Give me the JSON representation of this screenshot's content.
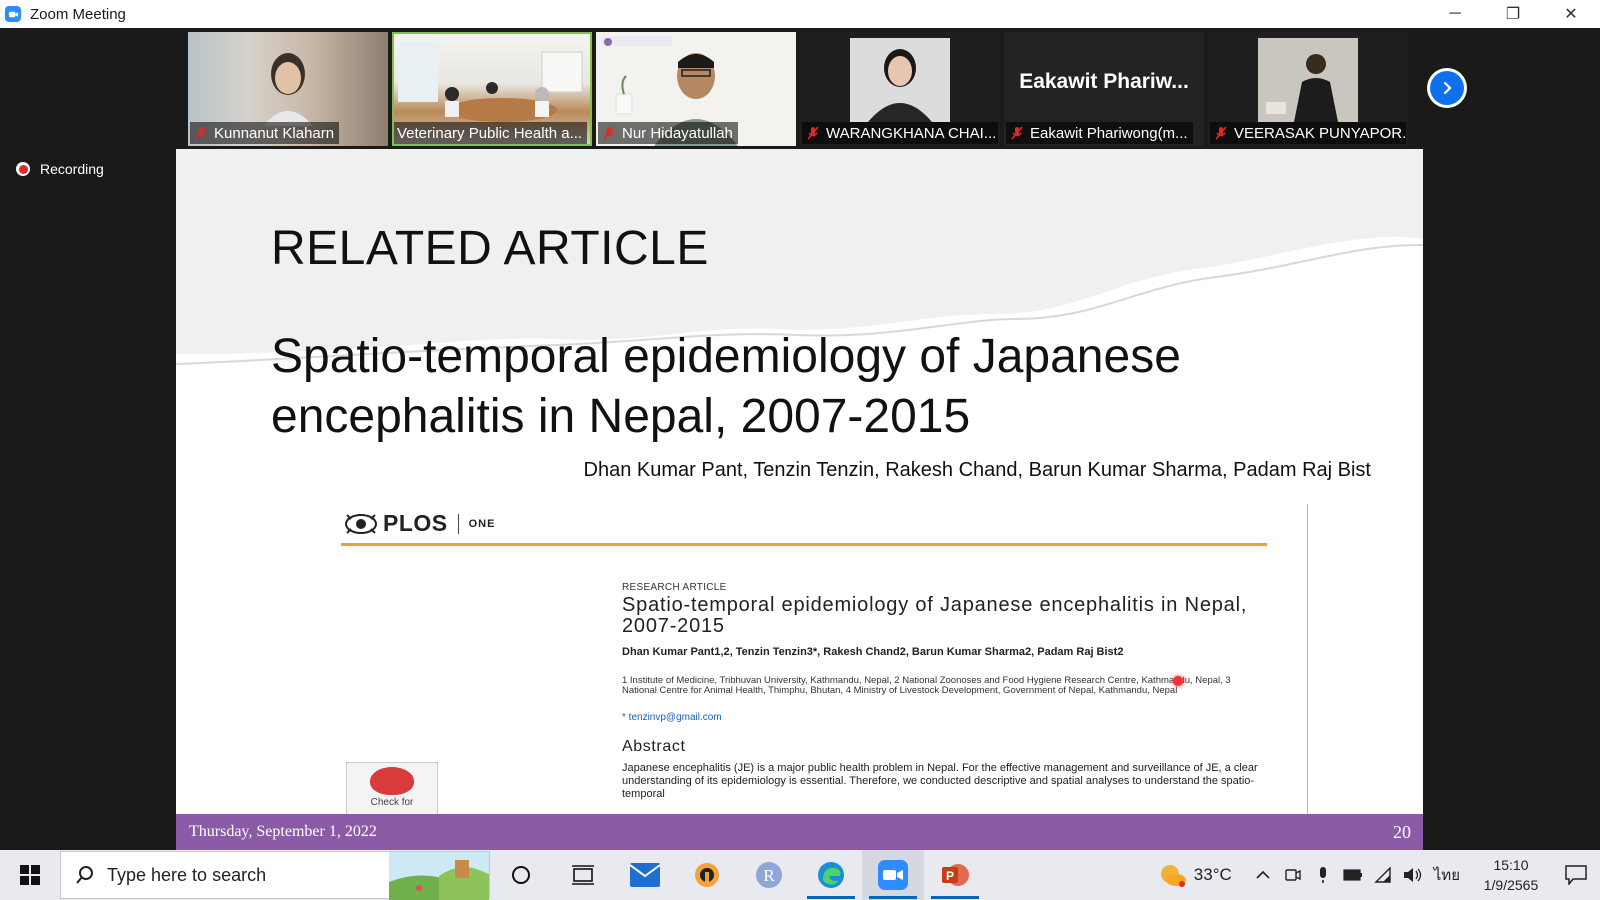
{
  "window": {
    "title": "Zoom Meeting",
    "controls": {
      "minimize": "─",
      "restore": "❐",
      "close": "✕"
    }
  },
  "participants": [
    {
      "name": "Kunnanut Klaharn",
      "muted": true
    },
    {
      "name": "Veterinary Public Health a...",
      "muted": false,
      "active_speaker": true
    },
    {
      "name": "Nur Hidayatullah",
      "muted": true
    },
    {
      "name": "WARANGKHANA CHAI...",
      "muted": true
    },
    {
      "name": "Eakawit Phariwong(m...",
      "muted": true,
      "display_name_large": "Eakawit  Phariw..."
    },
    {
      "name": "VEERASAK PUNYAPOR...",
      "muted": true
    }
  ],
  "recording": {
    "label": "Recording"
  },
  "slide": {
    "heading": "RELATED ARTICLE",
    "title": "Spatio-temporal epidemiology of Japanese encephalitis in Nepal, 2007-2015",
    "authors": "Dhan Kumar Pant, Tenzin Tenzin, Rakesh Chand, Barun Kumar Sharma, Padam Raj Bist",
    "footer_date": "Thursday, September 1, 2022",
    "page_number": "20",
    "paper": {
      "journal": "PLOS",
      "journal_sub": "ONE",
      "type": "RESEARCH ARTICLE",
      "title": "Spatio-temporal epidemiology of Japanese encephalitis in Nepal, 2007-2015",
      "authors": "Dhan Kumar Pant1,2, Tenzin Tenzin3*, Rakesh Chand2, Barun Kumar Sharma2, Padam Raj Bist2",
      "affiliations": "1 Institute of Medicine, Tribhuvan University, Kathmandu, Nepal, 2 National Zoonoses and Food Hygiene Research Centre, Kathmandu, Nepal, 3 National Centre for Animal Health, Thimphu, Bhutan, 4 Ministry of Livestock Development, Government of Nepal, Kathmandu, Nepal",
      "email": "* tenzinvp@gmail.com",
      "abstract_heading": "Abstract",
      "abstract": "Japanese encephalitis (JE) is a major public health problem in Nepal. For the effective management and surveillance of JE, a clear understanding of its epidemiology is essential. Therefore, we conducted descriptive and spatial analyses to understand the spatio-temporal",
      "check_badge": "Check for"
    }
  },
  "taskbar": {
    "search_placeholder": "Type here to search",
    "apps": [
      "cortana-icon",
      "task-view-icon",
      "mail-icon",
      "app-icon",
      "r-app-icon",
      "edge-icon",
      "zoom-icon",
      "powerpoint-icon"
    ],
    "weather": "33°C",
    "language": "ไทย",
    "time": "15:10",
    "date": "1/9/2565"
  },
  "colors": {
    "accent_blue": "#0e71eb",
    "slide_footer": "#8c5ba8",
    "active_outline": "#7ec24a",
    "recording_red": "#e02828"
  }
}
